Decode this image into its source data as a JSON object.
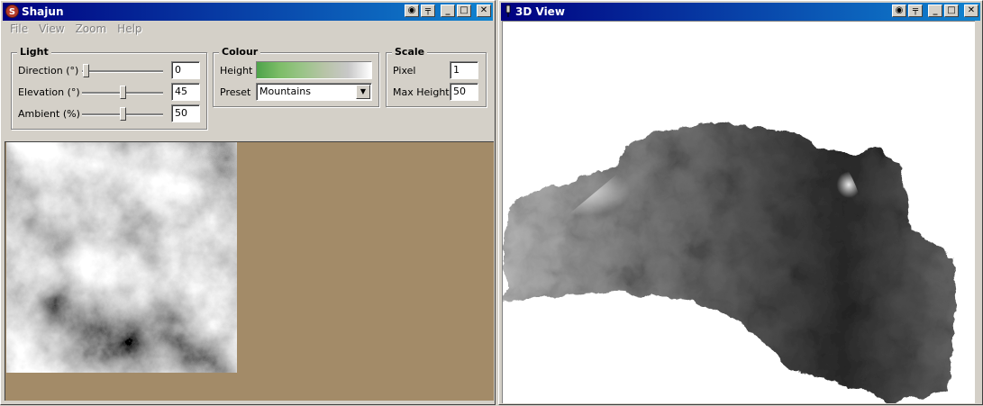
{
  "left_window": {
    "title": "Shajun",
    "menu": [
      "File",
      "View",
      "Zoom",
      "Help"
    ],
    "light": {
      "title": "Light",
      "direction": {
        "label": "Direction (°)",
        "value": "0"
      },
      "elevation": {
        "label": "Elevation (°)",
        "value": "45"
      },
      "ambient": {
        "label": "Ambient (%)",
        "value": "50"
      }
    },
    "colour": {
      "title": "Colour",
      "height_label": "Height",
      "preset_label": "Preset",
      "preset_value": "Mountains",
      "gradient_colors": [
        "#4ea34a",
        "#7dbd68",
        "#9ac488",
        "#b8c4a8",
        "#c8c8c8",
        "#ffffff"
      ]
    },
    "scale": {
      "title": "Scale",
      "pixel": {
        "label": "Pixel",
        "value": "1"
      },
      "max_height": {
        "label": "Max Height",
        "value": "50"
      }
    }
  },
  "right_window": {
    "title": "3D View"
  },
  "colors": {
    "title_start": "#000080",
    "title_end": "#1084d0",
    "canvas_bg": "#a38b68",
    "window_bg": "#d4d0c8"
  }
}
